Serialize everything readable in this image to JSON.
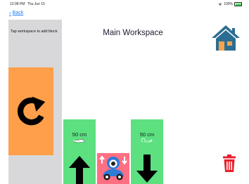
{
  "status": {
    "time": "12:08 PM",
    "date": "Thu Jun 15",
    "battery": "100%"
  },
  "nav": {
    "back_label": "Back"
  },
  "sidebar": {
    "hint": "Tap workspace to add block"
  },
  "workspace": {
    "title": "Main Workspace"
  },
  "blocks": [
    {
      "type": "forward",
      "distance": "50 cm",
      "speed": "fast"
    },
    {
      "type": "robot-lift"
    },
    {
      "type": "backward",
      "distance": "50 cm",
      "speed": "slow"
    }
  ],
  "colors": {
    "sidebar": "#d8d8da",
    "turn_block": "#ff9f4a",
    "move_block": "#5ce080",
    "robot_block": "#ff6f83",
    "home": "#2c6e93",
    "trash": "#e8202e",
    "link": "#1e7cf2"
  },
  "icons": [
    "wifi-icon",
    "battery-icon",
    "chevron-left-icon",
    "turn-arrow-icon",
    "home-icon",
    "rabbit-icon",
    "snail-icon",
    "arrow-up-icon",
    "arrow-down-icon",
    "robot-icon",
    "trash-icon"
  ]
}
